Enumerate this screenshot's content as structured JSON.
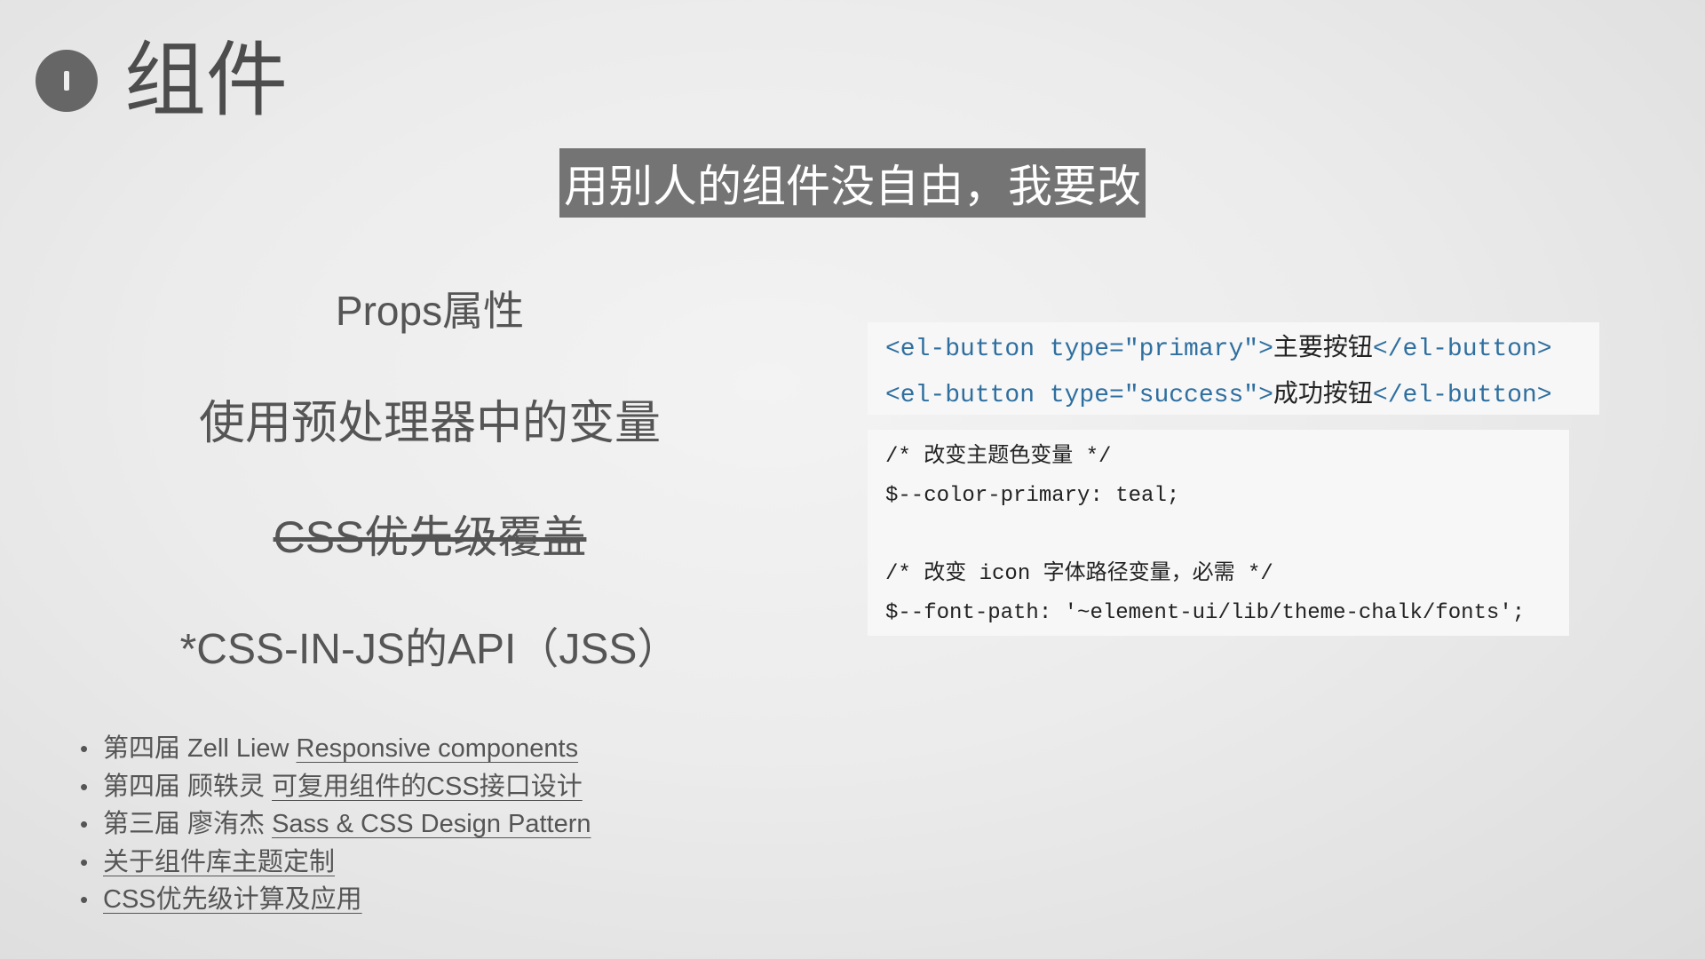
{
  "header": {
    "title": "组件",
    "badge_icon": "info-badge-icon"
  },
  "banner": {
    "text": "用别人的组件没自由，我要改"
  },
  "options": {
    "props": "Props属性",
    "vars": "使用预处理器中的变量",
    "css_override": "CSS优先级覆盖",
    "jss": "*CSS-IN-JS的API（JSS）"
  },
  "code1": {
    "line1": {
      "open": "<el-button type=",
      "attr": "\"primary\"",
      "close_open": ">",
      "text": "主要按钮",
      "end": "</el-button>"
    },
    "line2": {
      "open": "<el-button type=",
      "attr": "\"success\"",
      "close_open": ">",
      "text": "成功按钮",
      "end": "</el-button>"
    }
  },
  "code2": {
    "line1": "/* 改变主题色变量 */",
    "line2": "$--color-primary: teal;",
    "line3": "/* 改变 icon 字体路径变量，必需 */",
    "line4": "$--font-path: '~element-ui/lib/theme-chalk/fonts';"
  },
  "references": [
    {
      "prefix": "第四届 Zell Liew",
      "link": "Responsive components"
    },
    {
      "prefix": "第四届 顾轶灵",
      "link": "可复用组件的CSS接口设计"
    },
    {
      "prefix": "第三届 廖洧杰",
      "link": "Sass & CSS Design Pattern"
    },
    {
      "prefix": "",
      "link": "关于组件库主题定制"
    },
    {
      "prefix": "",
      "link": "CSS优先级计算及应用"
    }
  ],
  "bullet": "•",
  "colors": {
    "banner_bg": "#747474",
    "code_tag": "#2f6f9f",
    "text": "#555555"
  }
}
